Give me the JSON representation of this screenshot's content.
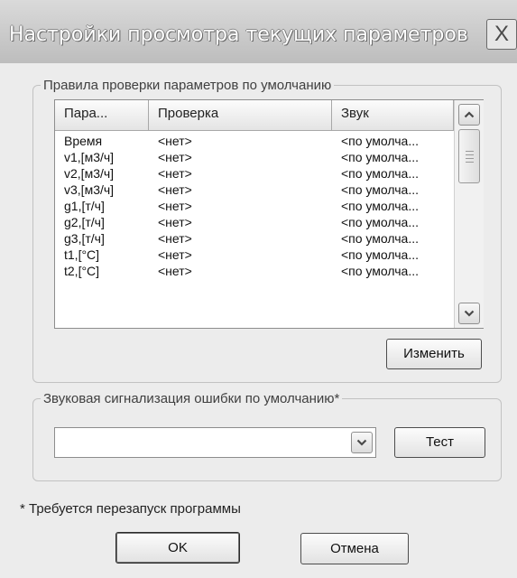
{
  "window": {
    "title": "Настройки просмотра текущих параметров",
    "close_label": "X"
  },
  "group_rules": {
    "legend": "Правила проверки параметров по умолчанию",
    "columns": [
      "Пара...",
      "Проверка",
      "Звук"
    ],
    "rows": [
      [
        "Время",
        "<нет>",
        "<по умолча..."
      ],
      [
        "v1,[м3/ч]",
        "<нет>",
        "<по умолча..."
      ],
      [
        "v2,[м3/ч]",
        "<нет>",
        "<по умолча..."
      ],
      [
        "v3,[м3/ч]",
        "<нет>",
        "<по умолча..."
      ],
      [
        "g1,[т/ч]",
        "<нет>",
        "<по умолча..."
      ],
      [
        "g2,[т/ч]",
        "<нет>",
        "<по умолча..."
      ],
      [
        "g3,[т/ч]",
        "<нет>",
        "<по умолча..."
      ],
      [
        "t1,[°C]",
        "<нет>",
        "<по умолча..."
      ],
      [
        "t2,[°C]",
        "<нет>",
        "<по умолча..."
      ]
    ],
    "change_button": "Изменить"
  },
  "group_sound": {
    "legend": "Звуковая сигнализация ошибки по умолчанию*",
    "selected_value": "",
    "test_button": "Тест"
  },
  "footnote": "* Требуется перезапуск программы",
  "buttons": {
    "ok": "OK",
    "cancel": "Отмена"
  },
  "icons": {
    "close": "close-icon",
    "scroll_up": "chevron-up-icon",
    "scroll_down": "chevron-down-icon",
    "combo": "chevron-down-icon"
  }
}
